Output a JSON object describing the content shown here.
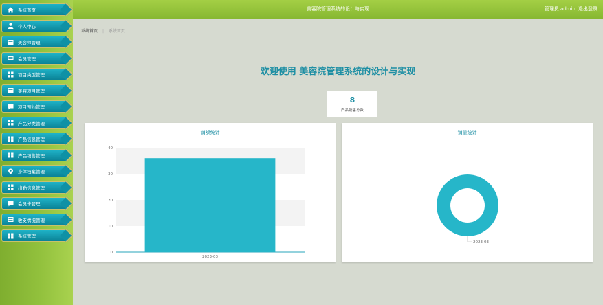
{
  "header": {
    "title": "美容院管理系统的设计与实现",
    "user": "管理员 admin",
    "logout": "退出登录"
  },
  "sidebar": {
    "items": [
      {
        "label": "系统首页",
        "icon": "home-icon"
      },
      {
        "label": "个人中心",
        "icon": "user-icon"
      },
      {
        "label": "美容师管理",
        "icon": "table-icon"
      },
      {
        "label": "会员管理",
        "icon": "table-icon"
      },
      {
        "label": "项目类型管理",
        "icon": "grid-icon"
      },
      {
        "label": "美容项目管理",
        "icon": "table-icon"
      },
      {
        "label": "项目预约管理",
        "icon": "chat-icon"
      },
      {
        "label": "产品分类管理",
        "icon": "grid-icon"
      },
      {
        "label": "产品信息管理",
        "icon": "grid-icon"
      },
      {
        "label": "产品销售管理",
        "icon": "grid-icon"
      },
      {
        "label": "身体档案管理",
        "icon": "pin-icon"
      },
      {
        "label": "出勤信息管理",
        "icon": "grid-icon"
      },
      {
        "label": "会员卡管理",
        "icon": "chat-icon"
      },
      {
        "label": "收支情况管理",
        "icon": "table-icon"
      },
      {
        "label": "系统管理",
        "icon": "grid-icon"
      }
    ],
    "accent": "#1fb3c8"
  },
  "breadcrumb": {
    "home": "系统首页",
    "current": "系统首页"
  },
  "welcome": "欢迎使用 美容院管理系统的设计与实现",
  "stat": {
    "value": "8",
    "label": "产品销售总数"
  },
  "chart_data": [
    {
      "type": "bar",
      "title": "销额统计",
      "categories": [
        "2023-03"
      ],
      "values": [
        36
      ],
      "ylim": [
        0,
        40
      ],
      "yticks": [
        0,
        10,
        20,
        30,
        40
      ],
      "ytick_labels": [
        "0",
        "10",
        "20",
        "30",
        "40"
      ],
      "color": "#26b6c9",
      "grid": "banded"
    },
    {
      "type": "pie",
      "style": "donut",
      "title": "销量统计",
      "labels": [
        "2023-03"
      ],
      "values": [
        8
      ],
      "color": "#26b6c9"
    }
  ]
}
